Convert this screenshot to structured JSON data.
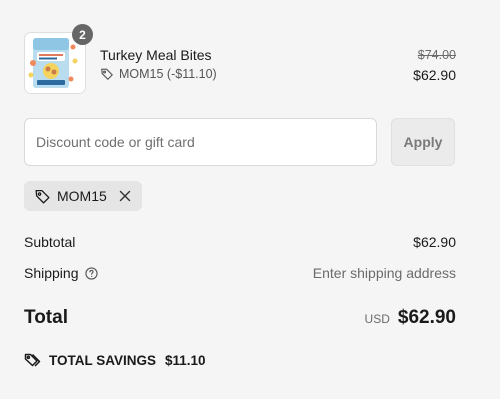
{
  "line_item": {
    "title": "Turkey Meal Bites",
    "quantity": "2",
    "discount_label": "MOM15 (-$11.10)",
    "original_price": "$74.00",
    "final_price": "$62.90",
    "icon": "tag-icon"
  },
  "discount_form": {
    "placeholder": "Discount code or gift card",
    "value": "",
    "apply_label": "Apply"
  },
  "applied_code": {
    "code": "MOM15",
    "icon": "tag-icon",
    "remove_icon": "close-icon"
  },
  "summary": {
    "subtotal_label": "Subtotal",
    "subtotal_value": "$62.90",
    "shipping_label": "Shipping",
    "shipping_value": "Enter shipping address",
    "total_label": "Total",
    "currency": "USD",
    "total_value": "$62.90"
  },
  "savings": {
    "label": "TOTAL SAVINGS",
    "amount": "$11.10",
    "icon": "tags-icon"
  },
  "colors": {
    "background": "#f5f5f5",
    "text": "#1a1a1a",
    "muted": "#6b6b6b",
    "badge": "#666666"
  }
}
